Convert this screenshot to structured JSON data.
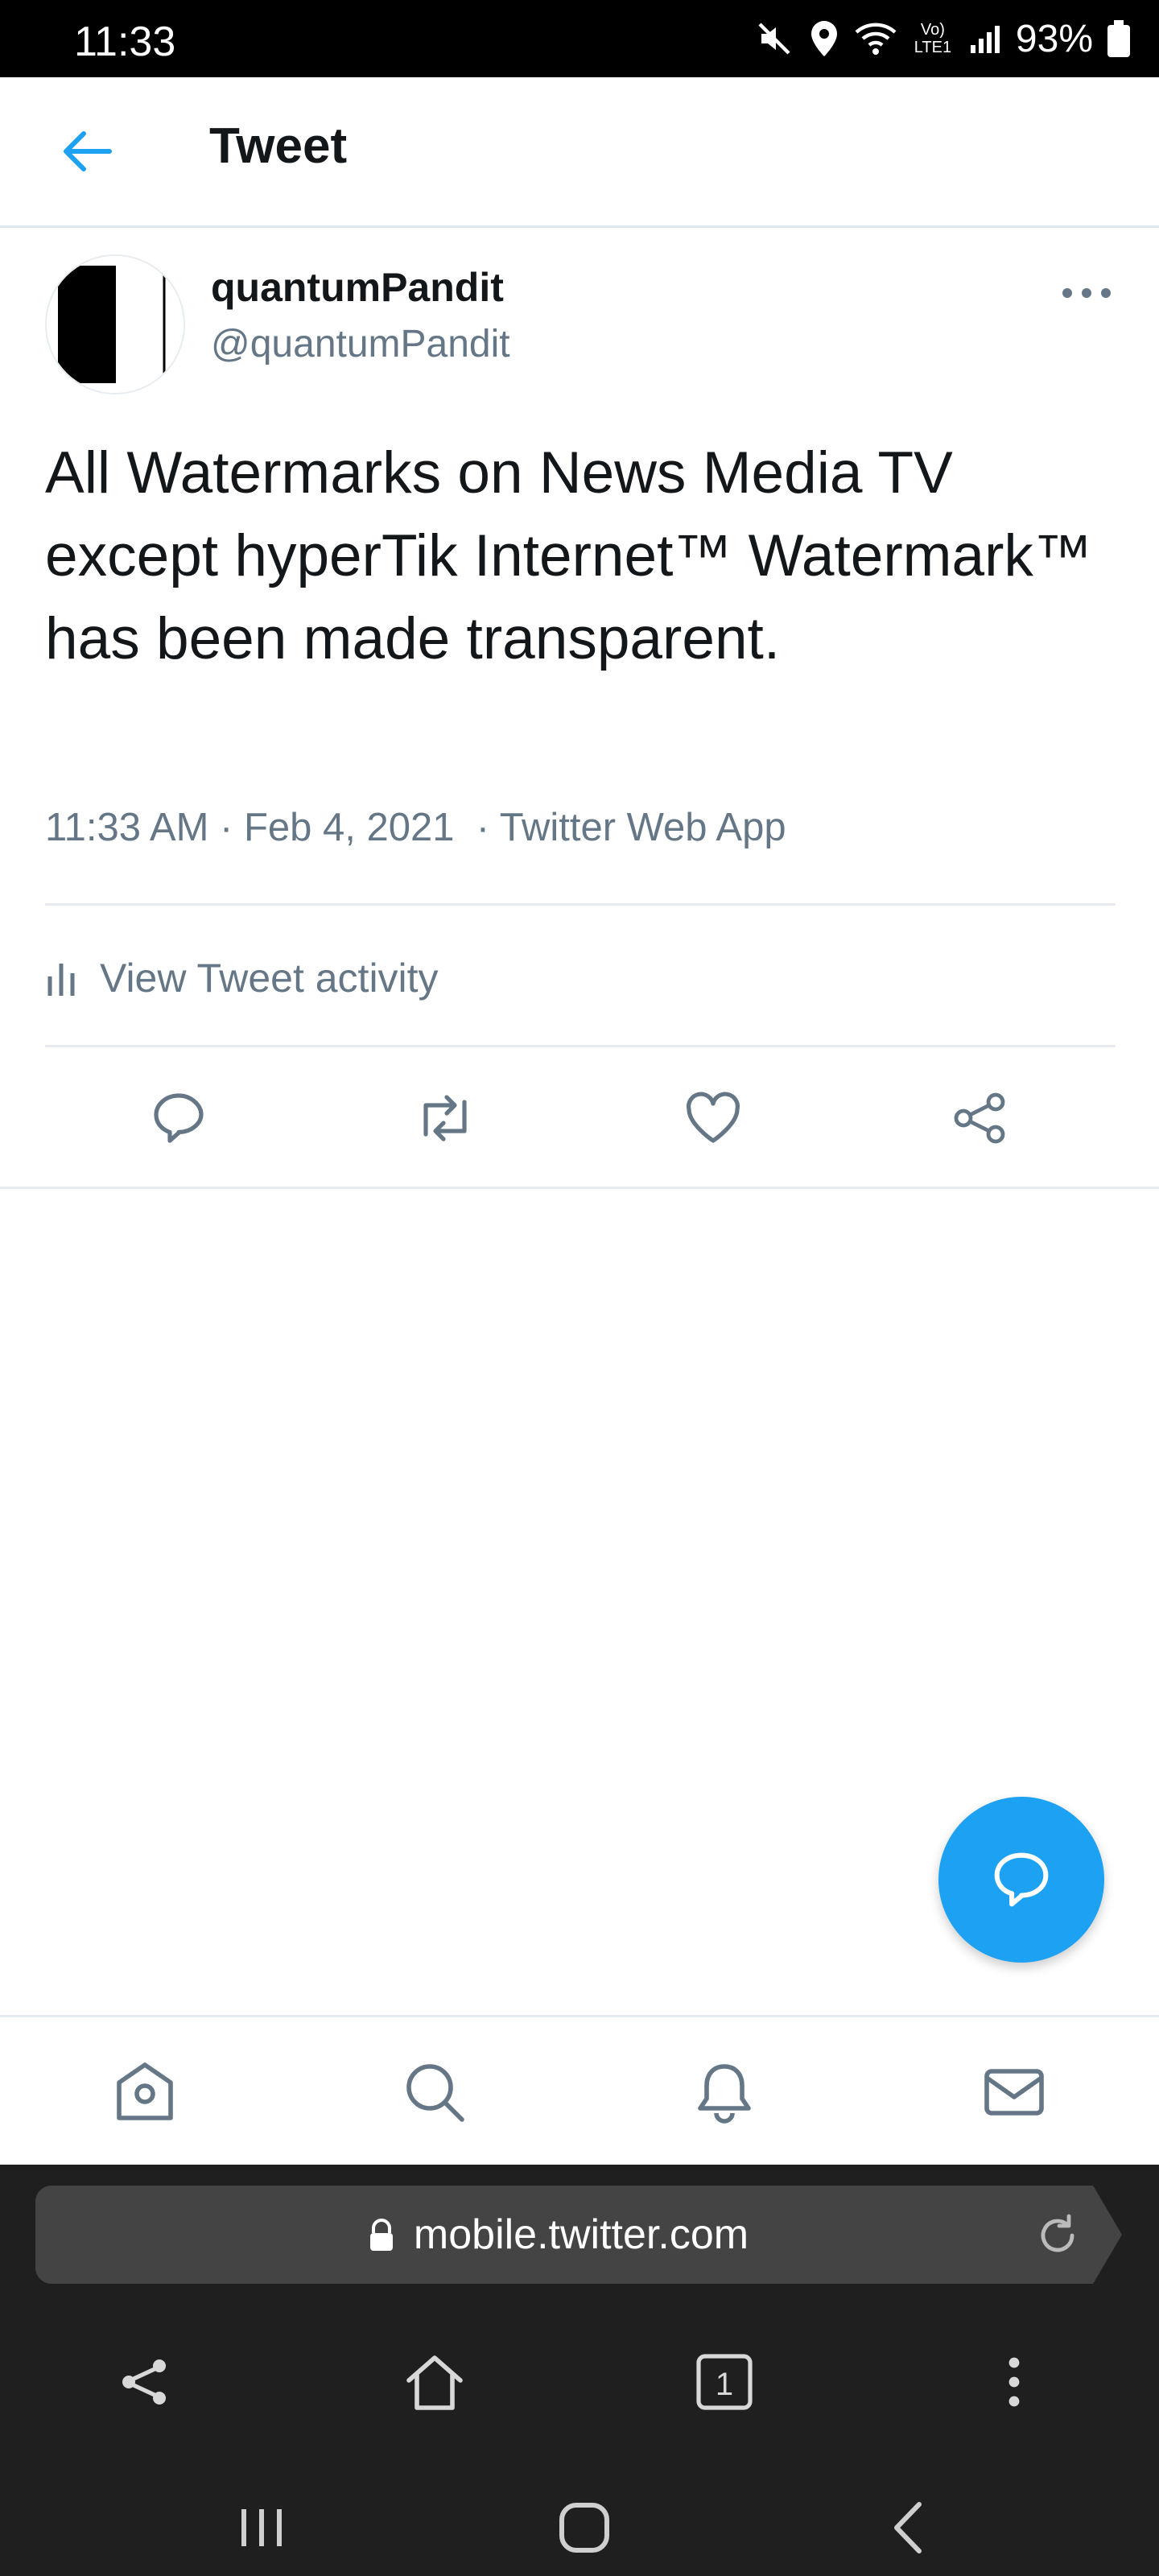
{
  "status_bar": {
    "time": "11:33",
    "battery": "93%",
    "network": "Vo) LTE1"
  },
  "header": {
    "title": "Tweet"
  },
  "tweet": {
    "author_name": "quantumPandit",
    "author_handle": "@quantumPandit",
    "text": "All Watermarks on News Media TV except hyperTik Internet™ Watermark™ has been made transparent.",
    "meta": "11:33 AM · Feb 4, 2021  · Twitter Web App"
  },
  "activity": {
    "label": "View Tweet activity"
  },
  "icons": {
    "back": "arrow-left-icon",
    "more": "more-horizontal-icon",
    "reply": "reply-icon",
    "retweet": "retweet-icon",
    "like": "heart-icon",
    "share": "share-icon",
    "compose": "compose-reply-icon",
    "home": "home-icon",
    "search": "search-icon",
    "notifications": "bell-icon",
    "messages": "mail-icon",
    "lock": "lock-icon",
    "reload": "reload-icon",
    "tabs": "tabs-icon",
    "menu": "kebab-menu-icon"
  },
  "browser": {
    "url": "mobile.twitter.com",
    "tab_count": "1"
  },
  "colors": {
    "accent": "#1da1f2",
    "text": "#14171a",
    "muted": "#657786",
    "browser_bg": "#1f1f1f"
  }
}
